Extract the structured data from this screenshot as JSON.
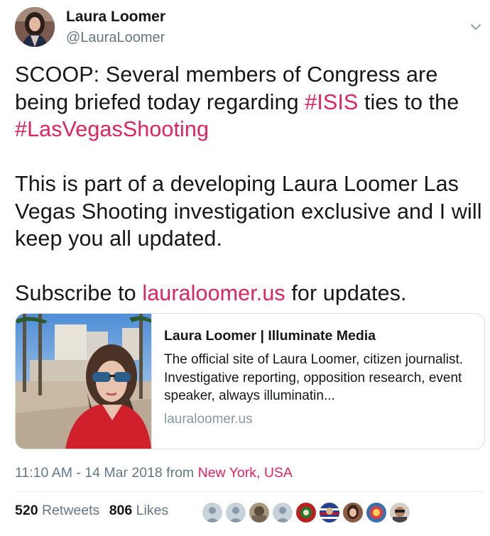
{
  "user": {
    "name": "Laura Loomer",
    "handle": "@LauraLoomer"
  },
  "tweet": {
    "line1_pre": "SCOOP: Several members of Congress are being briefed today regarding ",
    "hashtag1": "#ISIS",
    "line1_mid": " ties to the ",
    "hashtag2": "#LasVegasShooting",
    "para2": "This is part of a developing Laura Loomer Las Vegas Shooting investigation exclusive and I will keep you all updated.",
    "para3_pre": "Subscribe to ",
    "para3_link": "lauraloomer.us",
    "para3_post": " for updates."
  },
  "card": {
    "title": "Laura Loomer | Illuminate Media",
    "description": "The official site of Laura Loomer, citizen journalist. Investigative reporting, opposition research, event speaker, always illuminatin...",
    "domain": "lauraloomer.us"
  },
  "meta": {
    "time": "11:10 AM - 14 Mar 2018 from ",
    "location": "New York, USA"
  },
  "stats": {
    "retweets_count": "520",
    "retweets_label": "Retweets",
    "likes_count": "806",
    "likes_label": "Likes"
  },
  "colors": {
    "link": "#e0245e",
    "secondary": "#657786"
  }
}
